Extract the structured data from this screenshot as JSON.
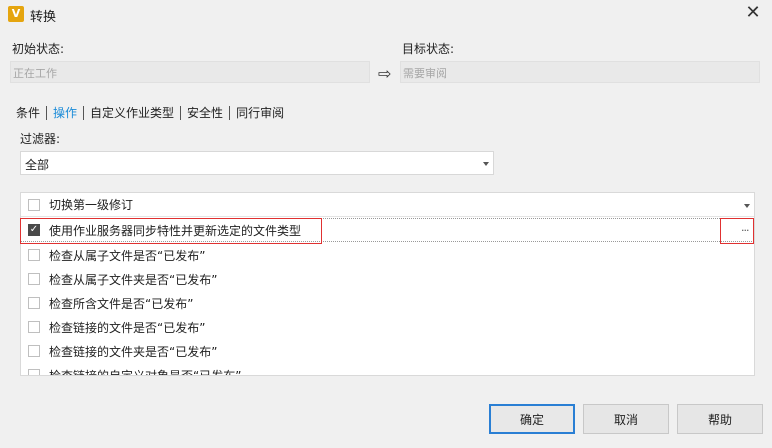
{
  "window": {
    "title": "转换",
    "app_icon_letter": "V"
  },
  "initial_state": {
    "label": "初始状态:",
    "value": "正在工作"
  },
  "target_state": {
    "label": "目标状态:",
    "value": "需要审阅"
  },
  "tabs": [
    "条件",
    "操作",
    "自定义作业类型",
    "安全性",
    "同行审阅"
  ],
  "active_tab": "操作",
  "filter": {
    "label": "过滤器:",
    "selected": "全部"
  },
  "actions": [
    {
      "label": "切换第一级修订",
      "checked": false
    },
    {
      "label": "使用作业服务器同步特性并更新选定的文件类型",
      "checked": true
    },
    {
      "label": "检查从属子文件是否“已发布”",
      "checked": false
    },
    {
      "label": "检查从属子文件夹是否“已发布”",
      "checked": false
    },
    {
      "label": "检查所含文件是否“已发布”",
      "checked": false
    },
    {
      "label": "检查链接的文件是否“已发布”",
      "checked": false
    },
    {
      "label": "检查链接的文件夹是否“已发布”",
      "checked": false
    },
    {
      "label": "检查链接的自定义对象是否“已发布”",
      "checked": false
    }
  ],
  "ellipsis_label": "···",
  "buttons": {
    "ok": "确定",
    "cancel": "取消",
    "help": "帮助"
  }
}
